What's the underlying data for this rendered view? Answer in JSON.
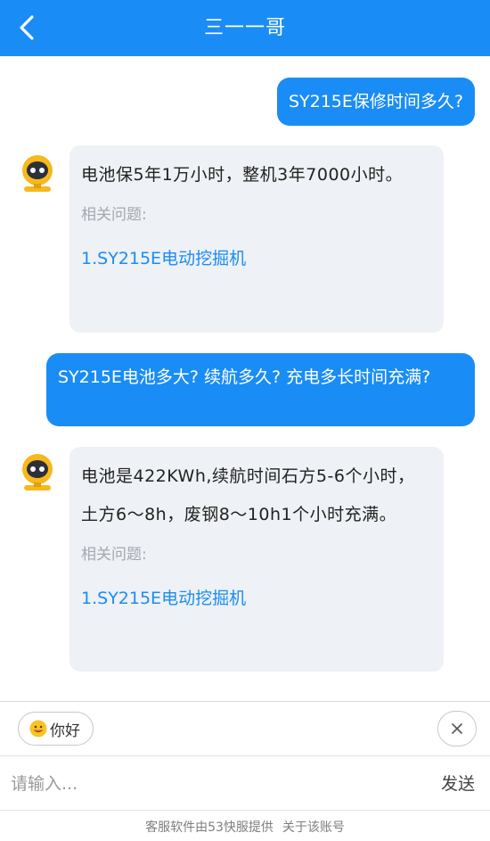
{
  "header": {
    "title": "三一一哥",
    "back_icon": "chevron-left-icon"
  },
  "colors": {
    "accent": "#1a8cf5",
    "bot_bubble": "#eef1f5",
    "link": "#1a8cf5"
  },
  "messages": [
    {
      "role": "user",
      "text": "SY215E保修时间多久?"
    },
    {
      "role": "bot",
      "text": "电池保5年1万小时，整机3年7000小时。",
      "related_label": "相关问题:",
      "related_link": "1.SY215E电动挖掘机"
    },
    {
      "role": "user",
      "text": "SY215E电池多大? 续航多久? 充电多长时间充满?"
    },
    {
      "role": "bot",
      "text": "电池是422KWh,续航时间石方5-6个小时，土方6～8h，废钢8～10h1个小时充满。",
      "related_label": "相关问题:",
      "related_link": "1.SY215E电动挖掘机"
    }
  ],
  "quick_reply": {
    "label": "你好",
    "icon": "smile-emoji-icon"
  },
  "input": {
    "placeholder": "请输入...",
    "value": "",
    "send_label": "发送"
  },
  "footer": {
    "provider": "客服软件由53快服提供",
    "account_link": "关于该账号"
  }
}
